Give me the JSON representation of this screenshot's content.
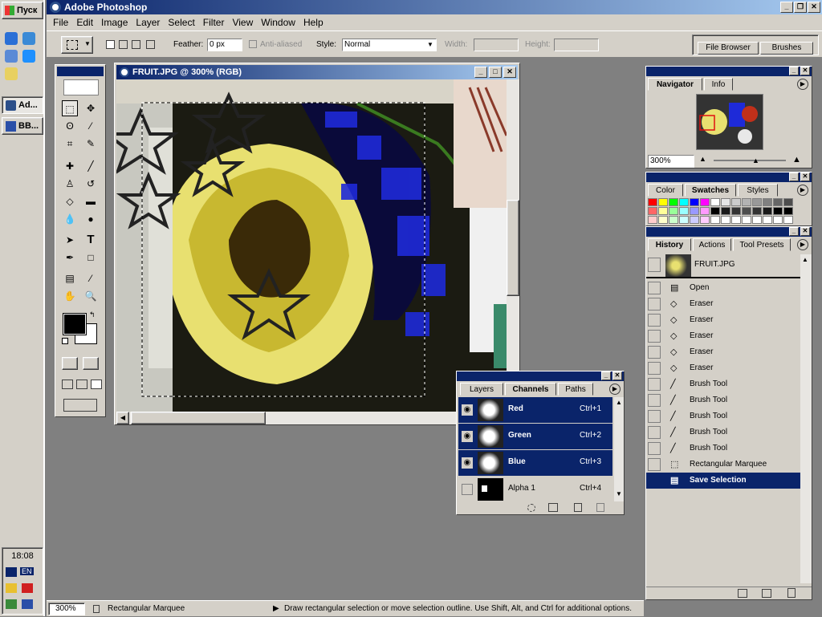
{
  "taskbar": {
    "start_label": "Пуск",
    "tasks": [
      {
        "label": "Ad..."
      },
      {
        "label": "BB..."
      }
    ],
    "clock": "18:08",
    "lang": "EN"
  },
  "app": {
    "title": "Adobe Photoshop",
    "menu": [
      "File",
      "Edit",
      "Image",
      "Layer",
      "Select",
      "Filter",
      "View",
      "Window",
      "Help"
    ]
  },
  "options": {
    "feather_label": "Feather:",
    "feather_value": "0 px",
    "antialias_label": "Anti-aliased",
    "style_label": "Style:",
    "style_value": "Normal",
    "width_label": "Width:",
    "height_label": "Height:",
    "well_tabs": [
      "File Browser",
      "Brushes"
    ]
  },
  "document": {
    "title": "FRUIT.JPG @ 300% (RGB)"
  },
  "navigator": {
    "tabs": [
      "Navigator",
      "Info"
    ],
    "zoom": "300%"
  },
  "color_palette": {
    "tabs": [
      "Color",
      "Swatches",
      "Styles"
    ],
    "swatch_row1": [
      "#ff0000",
      "#ffff00",
      "#00ff00",
      "#00ffff",
      "#0000ff",
      "#ff00ff",
      "#ffffff",
      "#e6e6e6",
      "#cccccc",
      "#b3b3b3",
      "#999999",
      "#808080",
      "#666666",
      "#4d4d4d"
    ],
    "swatch_row2": [
      "#ff6666",
      "#ffff99",
      "#99ff99",
      "#99ffff",
      "#9999ff",
      "#ff99ff",
      "#000000",
      "#1a1a1a",
      "#333333",
      "#4d4d4d",
      "#333333",
      "#1a1a1a",
      "#000000",
      "#000000"
    ],
    "swatch_row3": [
      "#ffcccc",
      "#ffffcc",
      "#ccffcc",
      "#ccffff",
      "#ccccff",
      "#ffccff",
      "#ffffff",
      "#ffffff",
      "#ffffff",
      "#ffffff",
      "#ffffff",
      "#ffffff",
      "#ffffff",
      "#ffffff"
    ]
  },
  "history": {
    "tabs": [
      "History",
      "Actions",
      "Tool Presets"
    ],
    "snapshot": "FRUIT.JPG",
    "items": [
      {
        "label": "Open",
        "icon": "document-icon"
      },
      {
        "label": "Eraser",
        "icon": "eraser-icon"
      },
      {
        "label": "Eraser",
        "icon": "eraser-icon"
      },
      {
        "label": "Eraser",
        "icon": "eraser-icon"
      },
      {
        "label": "Eraser",
        "icon": "eraser-icon"
      },
      {
        "label": "Eraser",
        "icon": "eraser-icon"
      },
      {
        "label": "Brush Tool",
        "icon": "brush-icon"
      },
      {
        "label": "Brush Tool",
        "icon": "brush-icon"
      },
      {
        "label": "Brush Tool",
        "icon": "brush-icon"
      },
      {
        "label": "Brush Tool",
        "icon": "brush-icon"
      },
      {
        "label": "Brush Tool",
        "icon": "brush-icon"
      },
      {
        "label": "Rectangular Marquee",
        "icon": "marquee-icon"
      },
      {
        "label": "Save Selection",
        "icon": "document-icon",
        "selected": true
      }
    ]
  },
  "channels": {
    "tabs": [
      "Layers",
      "Channels",
      "Paths"
    ],
    "items": [
      {
        "name": "Red",
        "shortcut": "Ctrl+1",
        "selected": true
      },
      {
        "name": "Green",
        "shortcut": "Ctrl+2",
        "selected": true
      },
      {
        "name": "Blue",
        "shortcut": "Ctrl+3",
        "selected": true
      },
      {
        "name": "Alpha 1",
        "shortcut": "Ctrl+4",
        "selected": false
      }
    ]
  },
  "status": {
    "zoom": "300%",
    "tool": "Rectangular Marquee",
    "hint": "Draw rectangular selection or move selection outline.  Use Shift, Alt, and Ctrl for additional options."
  },
  "colors": {
    "title_blue": "#0a246a",
    "selection": "#0a246a",
    "chrome": "#d4d0c8",
    "workspace": "#808080"
  }
}
